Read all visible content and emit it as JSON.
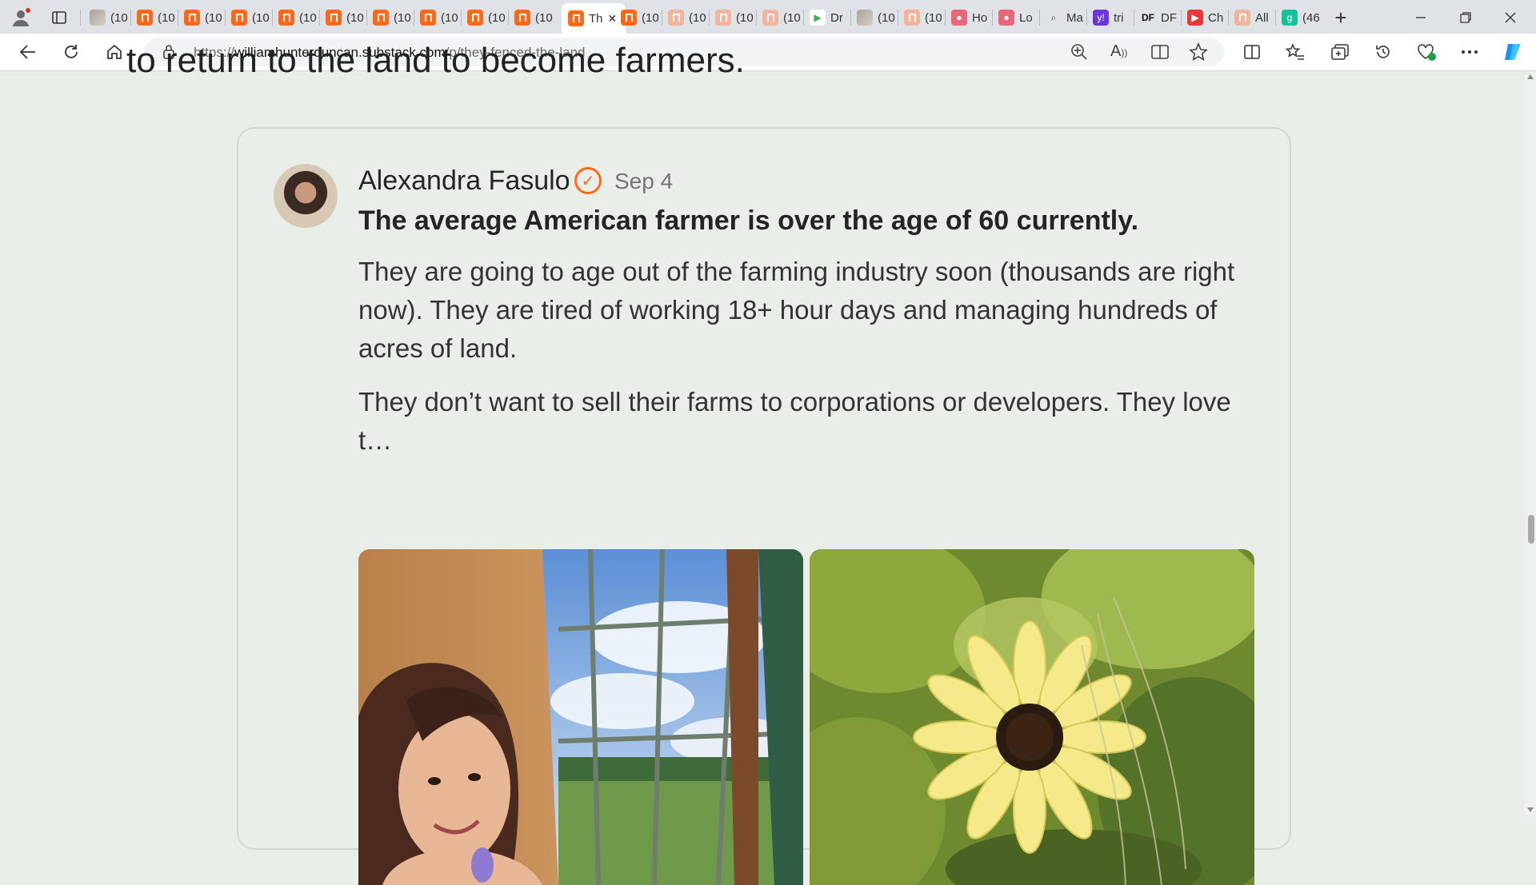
{
  "tabs": [
    {
      "label": "(10",
      "icon": "photo-favicon",
      "kind": "img"
    },
    {
      "label": "(10",
      "icon": "substack-favicon",
      "kind": "sub"
    },
    {
      "label": "(10",
      "icon": "substack-favicon",
      "kind": "sub"
    },
    {
      "label": "(10",
      "icon": "substack-favicon",
      "kind": "sub"
    },
    {
      "label": "(10",
      "icon": "substack-favicon",
      "kind": "sub"
    },
    {
      "label": "(10",
      "icon": "substack-favicon",
      "kind": "sub"
    },
    {
      "label": "(10",
      "icon": "substack-favicon",
      "kind": "sub"
    },
    {
      "label": "(10",
      "icon": "substack-favicon",
      "kind": "sub"
    },
    {
      "label": "(10",
      "icon": "substack-favicon",
      "kind": "sub"
    },
    {
      "label": "(10",
      "icon": "substack-favicon",
      "kind": "sub"
    },
    {
      "label": "Th",
      "icon": "substack-favicon",
      "kind": "active"
    },
    {
      "label": "(10",
      "icon": "substack-favicon",
      "kind": "sub"
    },
    {
      "label": "(10",
      "icon": "substack-favicon",
      "kind": "subf"
    },
    {
      "label": "(10",
      "icon": "substack-favicon",
      "kind": "subf"
    },
    {
      "label": "(10",
      "icon": "substack-favicon",
      "kind": "subf"
    },
    {
      "label": "Dr",
      "icon": "play-favicon",
      "kind": "play"
    },
    {
      "label": "(10",
      "icon": "photo-favicon",
      "kind": "img"
    },
    {
      "label": "(10",
      "icon": "substack-favicon",
      "kind": "subf"
    },
    {
      "label": "Ho",
      "icon": "pink-favicon",
      "kind": "pink"
    },
    {
      "label": "Lo",
      "icon": "pink-favicon",
      "kind": "pink"
    },
    {
      "label": "Ma",
      "icon": "search-favicon",
      "kind": "search"
    },
    {
      "label": "tri",
      "icon": "yahoo-favicon",
      "kind": "yahoo"
    },
    {
      "label": "DF",
      "icon": "df-favicon",
      "kind": "df"
    },
    {
      "label": "Ch",
      "icon": "youtube-favicon",
      "kind": "yt"
    },
    {
      "label": "All",
      "icon": "bookmark-favicon",
      "kind": "subf"
    },
    {
      "label": "(46",
      "icon": "g-favicon",
      "kind": "g"
    }
  ],
  "address": {
    "url_prefix": "https://",
    "url_domain": "williamhunterduncan.substack.com",
    "url_path": "/p/they-fenced-the-land"
  },
  "article": {
    "partial_line": "to return to the land to become farmers."
  },
  "comment": {
    "author": "Alexandra Fasulo",
    "date": "Sep 4",
    "headline": "The average American farmer is over the age of 60 currently.",
    "paragraph_1": "They are going to age out of the farming industry soon (thousands are right now). They are tired of working 18+ hour days and managing hundreds of acres of land.",
    "paragraph_2": "They don’t want to sell their farms to corporations or developers. They love t…"
  },
  "colors": {
    "page_bg": "#e9efe8",
    "accent": "#ff6719"
  }
}
